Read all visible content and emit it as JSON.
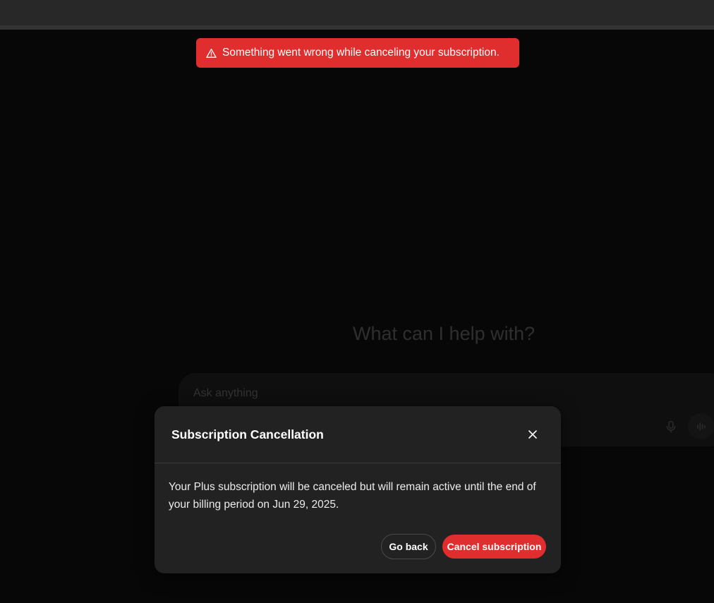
{
  "toast": {
    "message": "Something went wrong while canceling your subscription.",
    "icon": "warning-triangle-icon",
    "color": "#e02e2e"
  },
  "main": {
    "hero_title": "What can I help with?",
    "composer": {
      "placeholder": "Ask anything",
      "icons": [
        "microphone-icon",
        "voice-mode-icon"
      ]
    }
  },
  "modal": {
    "title": "Subscription Cancellation",
    "body": "Your Plus subscription will be canceled but will remain active until the end of your billing period on Jun 29, 2025.",
    "back_label": "Go back",
    "confirm_label": "Cancel subscription",
    "confirm_color": "#e02e2e"
  }
}
